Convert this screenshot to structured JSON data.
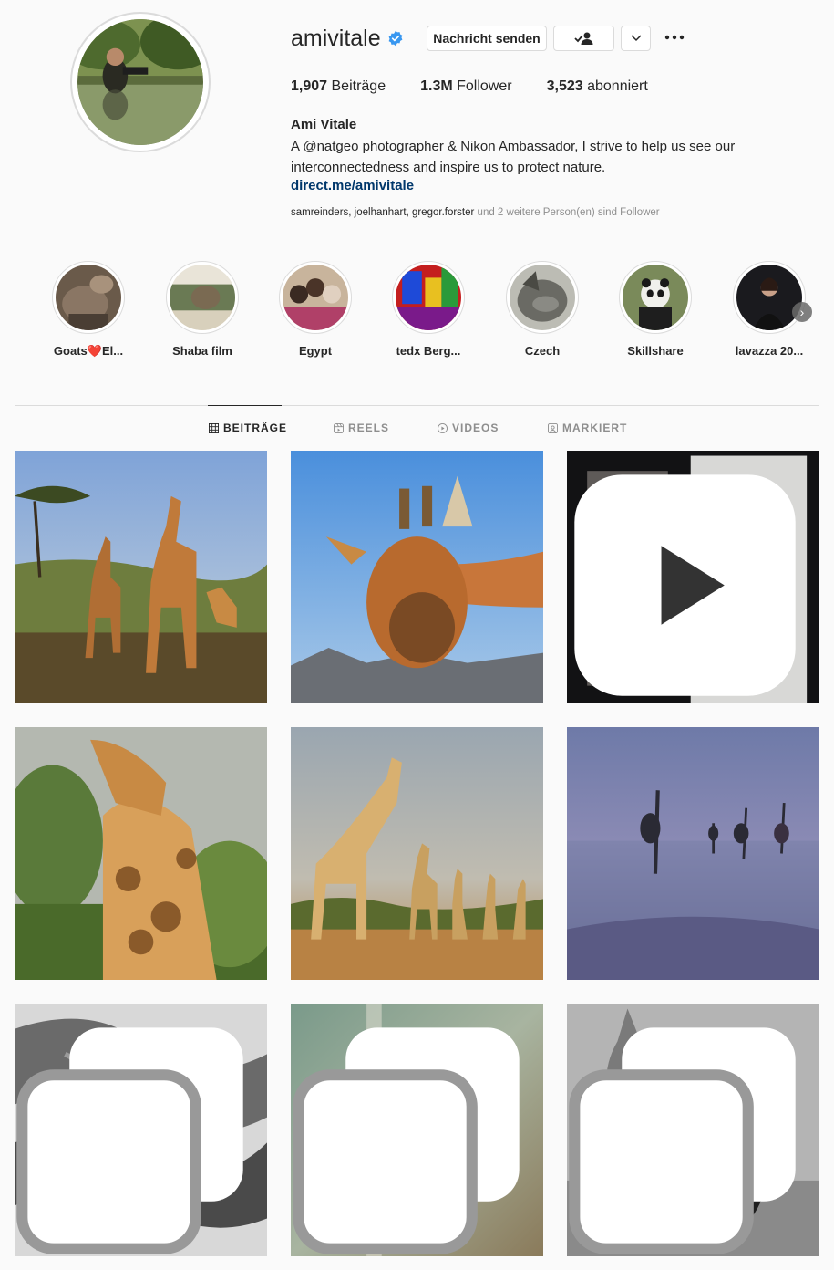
{
  "profile": {
    "username": "amivitale",
    "full_name": "Ami Vitale",
    "bio": "A @natgeo photographer & Nikon Ambassador, I strive to help us see our interconnectedness and inspire us to protect nature.",
    "link": "direct.me/amivitale",
    "stats": {
      "posts_value": "1,907",
      "posts_label": "Beiträge",
      "followers_value": "1.3M",
      "followers_label": "Follower",
      "following_value": "3,523",
      "following_label": "abonniert"
    },
    "followed_by": {
      "names": "samreinders, joelhanhart, gregor.forster",
      "rest": " und 2 weitere Person(en) sind Follower"
    }
  },
  "actions": {
    "message_label": "Nachricht senden"
  },
  "highlights": [
    {
      "label": "Goats❤️El..."
    },
    {
      "label": "Shaba film"
    },
    {
      "label": "Egypt"
    },
    {
      "label": "tedx Berg..."
    },
    {
      "label": "Czech"
    },
    {
      "label": "Skillshare"
    },
    {
      "label": "lavazza 20..."
    }
  ],
  "tabs": [
    {
      "label": "BEITRÄGE",
      "icon": "grid-icon",
      "active": true
    },
    {
      "label": "REELS",
      "icon": "reels-icon",
      "active": false
    },
    {
      "label": "VIDEOS",
      "icon": "video-play-icon",
      "active": false
    },
    {
      "label": "MARKIERT",
      "icon": "tagged-icon",
      "active": false
    }
  ],
  "colors": {
    "verified": "#3897f0",
    "link": "#00376b",
    "text": "#262626",
    "muted": "#8e8e8e",
    "border": "#dbdbdb"
  }
}
